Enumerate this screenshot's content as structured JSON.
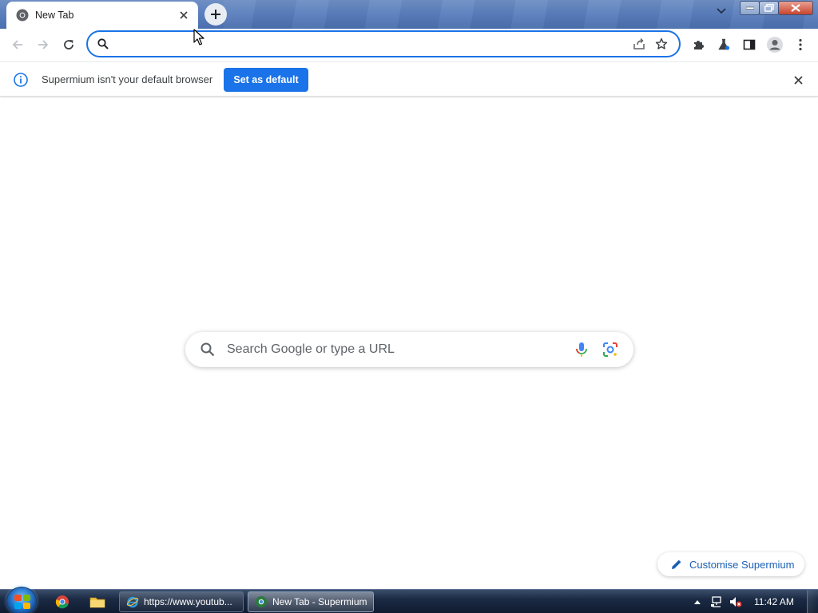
{
  "browser": {
    "tab": {
      "title": "New Tab"
    },
    "omnibox": {
      "value": "",
      "placeholder": ""
    },
    "infobar": {
      "message": "Supermium isn't your default browser",
      "button_label": "Set as default"
    }
  },
  "ntp": {
    "search_placeholder": "Search Google or type a URL",
    "customise_label": "Customise Supermium"
  },
  "taskbar": {
    "tasks": [
      {
        "label": "https://www.youtub..."
      },
      {
        "label": "New Tab - Supermium"
      }
    ],
    "clock": "11:42 AM"
  },
  "colors": {
    "accent": "#1a73e8",
    "taskbar": "#1b2a44",
    "titlebar": "#5b80be"
  }
}
